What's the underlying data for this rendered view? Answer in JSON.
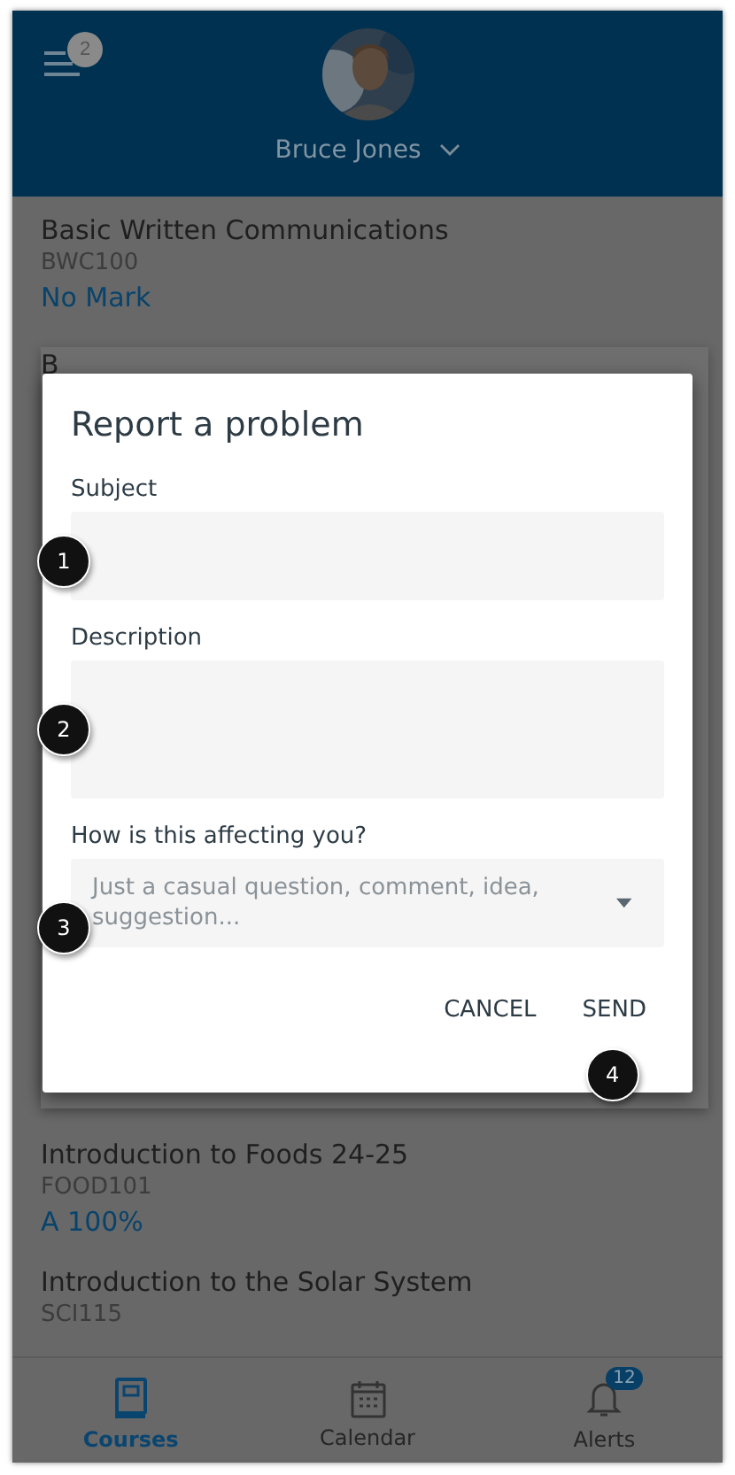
{
  "header": {
    "menu_badge": "2",
    "user_name": "Bruce Jones"
  },
  "courses_above": [
    {
      "name": "Basic Written Communications",
      "code": "BWC100",
      "grade": "No Mark"
    }
  ],
  "covered_card": {
    "title": "B"
  },
  "courses_below": [
    {
      "name": "Introduction to Foods 24-25",
      "code": "FOOD101",
      "grade": "A 100%"
    },
    {
      "name": "Introduction to the Solar System",
      "code": "SCI115"
    }
  ],
  "dialog": {
    "title": "Report a problem",
    "fields": [
      {
        "kind": "text",
        "label": "Subject",
        "callout": "1"
      },
      {
        "kind": "textarea",
        "label": "Description",
        "callout": "2"
      },
      {
        "kind": "select",
        "label": "How is this affecting you?",
        "placeholder": "Just a casual question, comment, idea, suggestion...",
        "callout": "3"
      }
    ],
    "buttons": [
      {
        "label": "CANCEL"
      },
      {
        "label": "SEND",
        "callout": "4"
      }
    ]
  },
  "tabs": [
    {
      "kind": "courses",
      "label": "Courses",
      "selected": true
    },
    {
      "kind": "calendar",
      "label": "Calendar",
      "selected": false
    },
    {
      "kind": "alerts",
      "label": "Alerts",
      "selected": false,
      "badge": "12"
    }
  ]
}
